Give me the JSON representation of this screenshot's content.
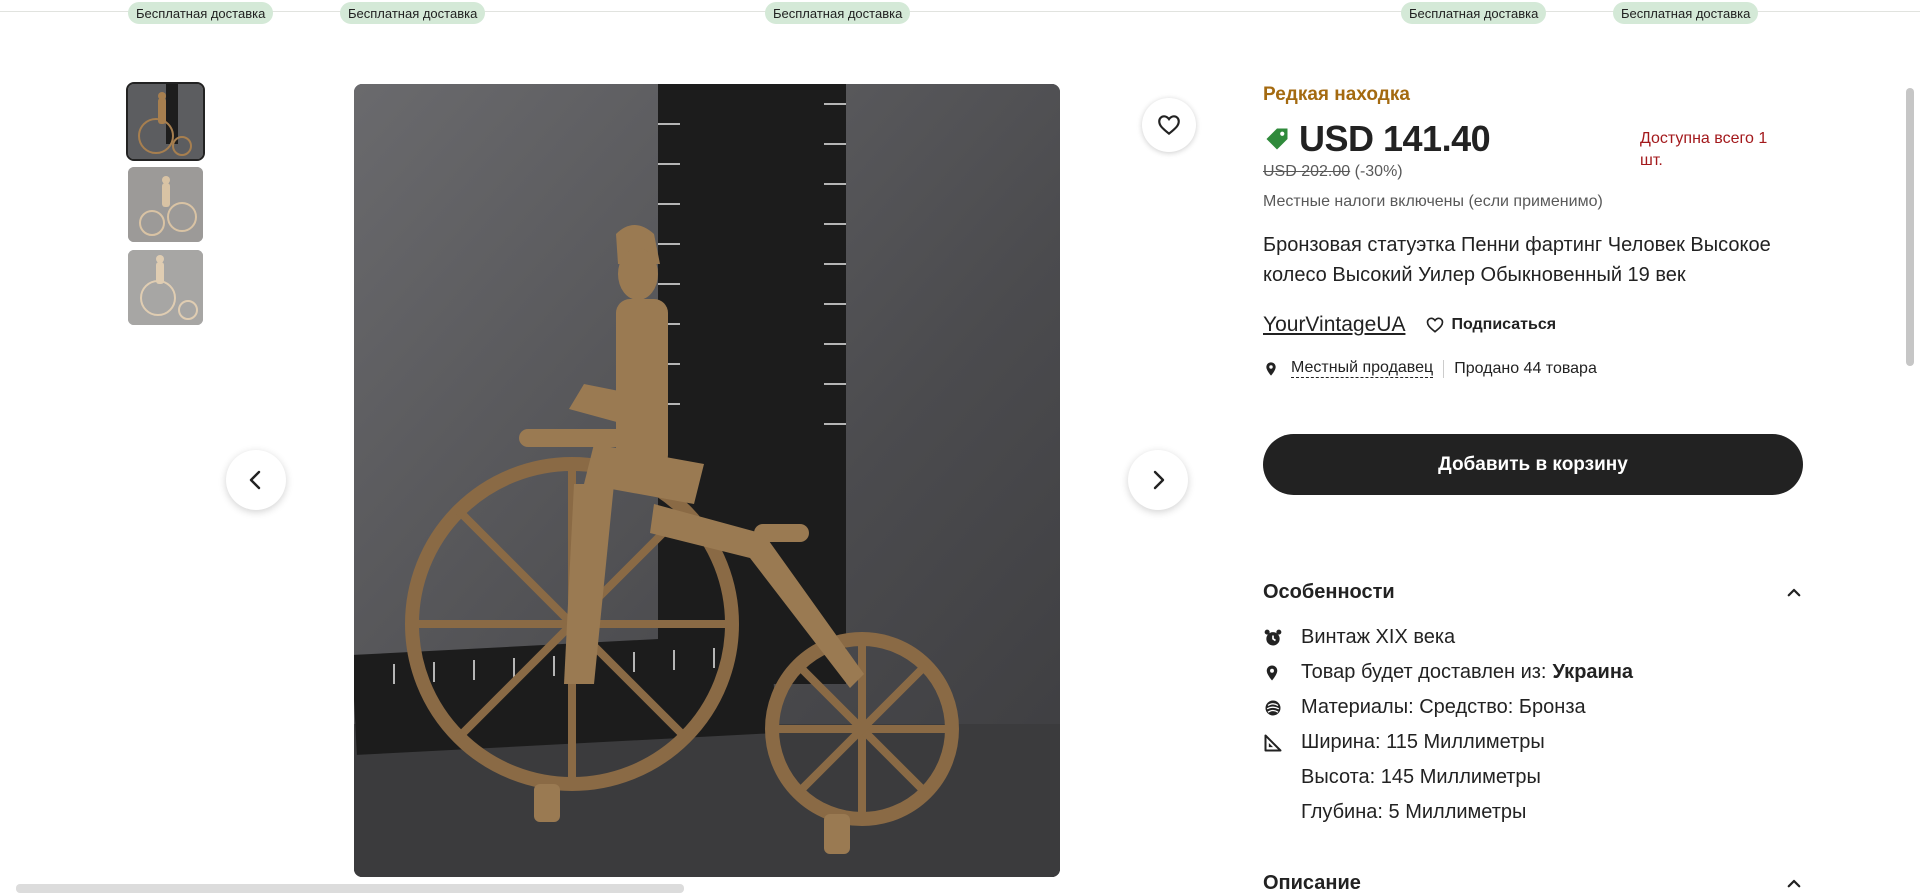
{
  "shipping_badges": [
    "Бесплатная доставка",
    "Бесплатная доставка",
    "Бесплатная доставка",
    "Бесплатная доставка",
    "Бесплатная доставка"
  ],
  "product": {
    "rare_label": "Редкая находка",
    "price": "USD 141.40",
    "old_price": "USD 202.00",
    "discount": "(-30%)",
    "stock": "Доступна всего 1 шт.",
    "tax_note": "Местные налоги включены (если применимо)",
    "title": "Бронзовая статуэтка Пенни фартинг Человек Высокое колесо Высокий Уилер Обыкновенный 19 век"
  },
  "shop": {
    "name": "YourVintageUA",
    "follow_label": "Подписаться",
    "local_seller": "Местный продавец",
    "sold": "Продано 44 товара"
  },
  "cart": {
    "label": "Добавить в корзину"
  },
  "features": {
    "heading": "Особенности",
    "vintage": "Винтаж XIX века",
    "ships_from_label": "Товар будет доставлен из:",
    "ships_from_value": "Украина",
    "materials": "Материалы: Средство: Бронза",
    "width": "Ширина: 115 Миллиметры",
    "height": "Высота: 145 Миллиметры",
    "depth": "Глубина: 5 Миллиметры"
  },
  "description": {
    "heading": "Описание"
  },
  "gallery": {
    "thumb_count": 3,
    "active_index": 0
  },
  "colors": {
    "accent_gold": "#a46a10",
    "stock_red": "#a3191c",
    "badge_green": "#d4e9d7",
    "tag_green": "#2f8a3b",
    "button_dark": "#222222"
  },
  "icons": [
    "tag-icon",
    "heart-icon",
    "chevron-left-icon",
    "chevron-right-icon",
    "location-pin-icon",
    "chevron-up-icon",
    "alarm-clock-icon",
    "materials-icon",
    "ruler-triangle-icon"
  ]
}
